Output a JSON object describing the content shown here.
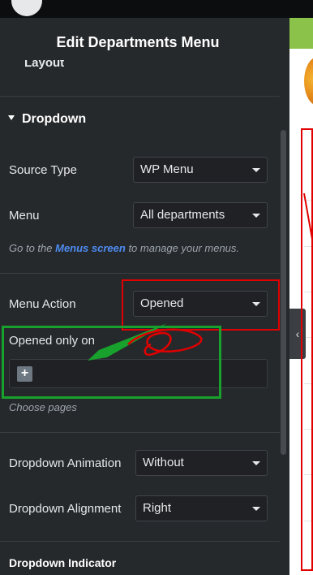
{
  "header": {
    "title": "Edit Departments Menu"
  },
  "previous_section": {
    "label": "Layout"
  },
  "section": {
    "title": "Dropdown"
  },
  "fields": {
    "source_type": {
      "label": "Source Type",
      "value": "WP Menu"
    },
    "menu": {
      "label": "Menu",
      "value": "All departments"
    },
    "menu_hint": {
      "prefix": "Go to the",
      "link": "Menus screen",
      "suffix": "to manage your menus."
    },
    "menu_action": {
      "label": "Menu Action",
      "value": "Opened"
    },
    "opened_only_on": {
      "label": "Opened only on",
      "add_icon": "plus-icon",
      "hint": "Choose pages"
    },
    "dropdown_animation": {
      "label": "Dropdown Animation",
      "value": "Without"
    },
    "dropdown_alignment": {
      "label": "Dropdown Alignment",
      "value": "Right"
    },
    "dropdown_indicator": {
      "label": "Dropdown Indicator"
    }
  },
  "collapse_toggle": {
    "icon": "chevron-left-icon",
    "glyph": "‹"
  },
  "colors": {
    "panel_bg": "#26292c",
    "field_bg": "#1f2124",
    "link": "#4d8cf2",
    "annotation_red": "#e00000",
    "annotation_green": "#18a12c",
    "preview_green": "#8bc34a"
  }
}
